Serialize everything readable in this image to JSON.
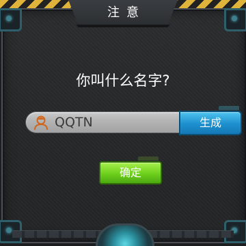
{
  "dialog": {
    "title": "注意",
    "question": "你叫什么名字?"
  },
  "name_input": {
    "value": "QQTN",
    "icon": "user-avatar-icon"
  },
  "buttons": {
    "generate_label": "生成",
    "confirm_label": "确定"
  },
  "colors": {
    "generate_button": "#1c8fcf",
    "confirm_button": "#6dd01c",
    "panel": "#26282a",
    "hazard_stripe": "#e0b43a"
  }
}
